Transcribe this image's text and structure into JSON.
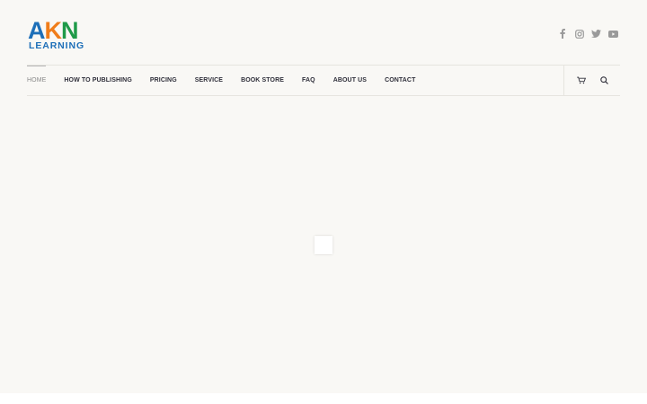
{
  "logo": {
    "letters": [
      "A",
      "K",
      "N"
    ],
    "subtext": "LEARNING",
    "colors": {
      "a": "#1d6fb8",
      "k": "#f07d1a",
      "n": "#1f9a48",
      "subtext": "#1d6fb8"
    }
  },
  "social": {
    "icons": [
      "facebook-icon",
      "instagram-icon",
      "twitter-icon",
      "youtube-icon"
    ],
    "color": "#9a9a9a"
  },
  "nav": {
    "items": [
      {
        "label": "HOME",
        "active": true
      },
      {
        "label": "HOW TO PUBLISHING",
        "active": false
      },
      {
        "label": "PRICING",
        "active": false
      },
      {
        "label": "SERVICE",
        "active": false
      },
      {
        "label": "BOOK STORE",
        "active": false
      },
      {
        "label": "FAQ",
        "active": false
      },
      {
        "label": "ABOUT US",
        "active": false
      },
      {
        "label": "CONTACT",
        "active": false
      }
    ],
    "icons": [
      "cart-icon",
      "search-icon"
    ]
  },
  "colors": {
    "background": "#f9f8f5",
    "nav_text": "#2f2f3a",
    "nav_active": "#8a8a8a",
    "border": "#e6e4df"
  }
}
